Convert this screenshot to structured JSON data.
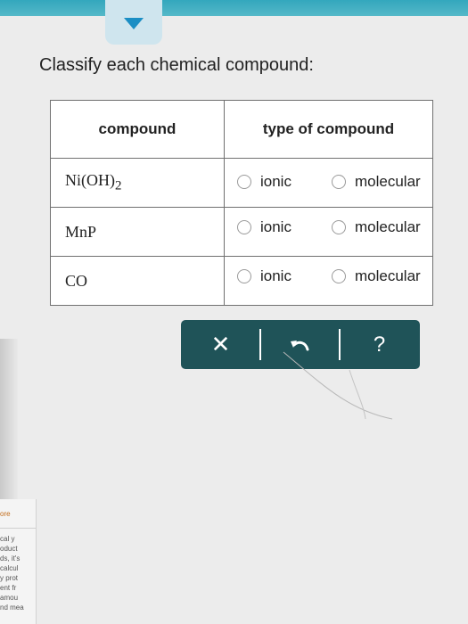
{
  "prompt": "Classify each chemical compound:",
  "table": {
    "headers": [
      "compound",
      "type of compound"
    ],
    "rows": [
      {
        "formula": "Ni(OH)",
        "subscript": "2",
        "options": [
          "ionic",
          "molecular"
        ]
      },
      {
        "formula": "MnP",
        "subscript": "",
        "options": [
          "ionic",
          "molecular"
        ]
      },
      {
        "formula": "CO",
        "subscript": "",
        "options": [
          "ionic",
          "molecular"
        ]
      }
    ]
  },
  "toolbar": {
    "clear_symbol": "✕",
    "help_symbol": "?"
  },
  "background_fragments": [
    "ore",
    "cal y",
    "oduct",
    "ds, it's",
    "calcul",
    "y prot",
    "ent fr",
    "amou",
    "nd mea"
  ],
  "colors": {
    "topbar": "#3aaac0",
    "toolbar": "#1f5358",
    "dropdown_icon": "#1b8ec4"
  }
}
